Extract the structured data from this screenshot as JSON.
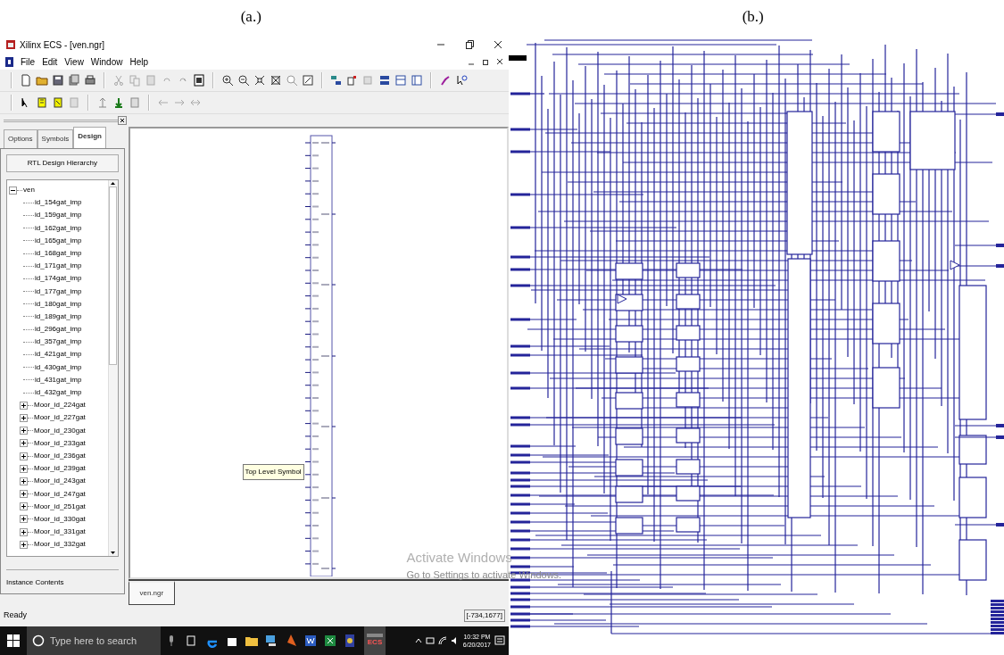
{
  "captions": [
    "(a.)",
    "(b.)"
  ],
  "window": {
    "title": "Xilinx ECS - [ven.ngr]"
  },
  "menu": [
    "File",
    "Edit",
    "View",
    "Window",
    "Help"
  ],
  "panel_tabs": [
    {
      "label": "Options",
      "selected": false
    },
    {
      "label": "Symbols",
      "selected": false
    },
    {
      "label": "Design",
      "selected": true
    }
  ],
  "hierarchy": {
    "title": "RTL Design Hierarchy",
    "tree": [
      {
        "label": "ven",
        "expanded": true,
        "children": [
          {
            "label": "id_154gat_imp"
          },
          {
            "label": "id_159gat_imp"
          },
          {
            "label": "id_162gat_imp"
          },
          {
            "label": "id_165gat_imp"
          },
          {
            "label": "id_168gat_imp"
          },
          {
            "label": "id_171gat_imp"
          },
          {
            "label": "id_174gat_imp"
          },
          {
            "label": "id_177gat_imp"
          },
          {
            "label": "id_180gat_imp"
          },
          {
            "label": "id_189gat_imp"
          },
          {
            "label": "id_296gat_imp"
          },
          {
            "label": "id_357gat_imp"
          },
          {
            "label": "id_421gat_imp"
          },
          {
            "label": "id_430gat_imp"
          },
          {
            "label": "id_431gat_imp"
          },
          {
            "label": "id_432gat_imp"
          },
          {
            "label": "Moor_id_224gat",
            "expanded": false
          },
          {
            "label": "Moor_id_227gat",
            "expanded": false
          },
          {
            "label": "Moor_id_230gat",
            "expanded": false
          },
          {
            "label": "Moor_id_233gat",
            "expanded": false
          },
          {
            "label": "Moor_id_236gat",
            "expanded": false
          },
          {
            "label": "Moor_id_239gat",
            "expanded": false
          },
          {
            "label": "Moor_id_243gat",
            "expanded": false
          },
          {
            "label": "Moor_id_247gat",
            "expanded": false
          },
          {
            "label": "Moor_id_251gat",
            "expanded": false
          },
          {
            "label": "Moor_id_330gat",
            "expanded": false
          },
          {
            "label": "Moor_id_331gat",
            "expanded": false
          },
          {
            "label": "Moor_id_332gat",
            "expanded": false
          }
        ]
      }
    ]
  },
  "instance_contents": "Instance Contents",
  "canvas": {
    "tooltip": "Top Level Symbol",
    "document_tabs": [
      {
        "label": "ven.ngr",
        "selected": true
      }
    ]
  },
  "activation_notice": {
    "title": "Activate Windows",
    "hint": "Go to Settings to activate Windows."
  },
  "status_bar": {
    "message": "Ready",
    "coordinates": "[-734,1677]"
  },
  "taskbar": {
    "search": {
      "placeholder": "Type here to search"
    },
    "active_app_label": "ECS",
    "time": "10:32 PM",
    "date": "6/20/2017"
  }
}
